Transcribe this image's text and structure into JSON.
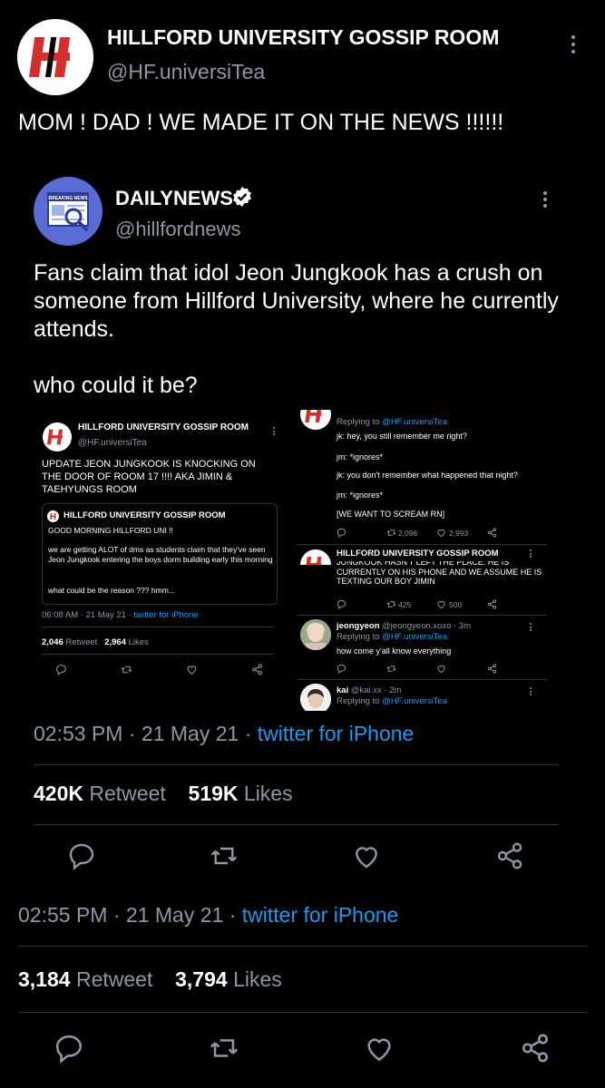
{
  "main": {
    "name": "HILLFORD UNIVERSITY GOSSIP ROOM",
    "handle": "@HF.universiTea",
    "text": "MOM ! DAD ! WE MADE IT ON THE NEWS !!!!!!",
    "time": "02:55 PM",
    "date": "21 May 21",
    "source": "twitter for iPhone",
    "retweet_count": "3,184",
    "retweet_label": "Retweet",
    "like_count": "3,794",
    "like_label": "Likes"
  },
  "quote": {
    "name": "DAILYNEWS",
    "handle": "@hillfordnews",
    "avatar_badge": "BREAKING NEWS",
    "text_1": "Fans claim that idol Jeon Jungkook has a crush on someone from Hillford University, where he currently attends.",
    "text_2": "who could it be?",
    "time": "02:53 PM",
    "date": "21 May 21",
    "source": "twitter for iPhone",
    "retweet_count": "420K",
    "retweet_label": "Retweet",
    "like_count": "519K",
    "like_label": "Likes"
  },
  "left_shot": {
    "name": "HILLFORD UNIVERSITY GOSSIP ROOM",
    "handle": "@HF.universiTea",
    "text": "UPDATE JEON JUNGKOOK IS KNOCKING ON THE DOOR OF ROOM 17 !!!! AKA JIMIN & TAEHYUNGS ROOM",
    "inner_name": "HILLFORD UNIVERSITY GOSSIP ROOM",
    "inner_line1": "GOOD MORNING HILLFORD UNI !!",
    "inner_line2": "we are getting ALOT of dms as students claim that they've seen Jeon Jungkook entering the boys dorm building early this morning",
    "inner_line3": "what could be the reason ??? hmm...",
    "meta_time": "06:08 AM · 21 May 21 ·",
    "meta_source": "twitter for iPhone",
    "retweet_count": "2,046",
    "retweet_label": "Retweet",
    "like_count": "2,964",
    "like_label": "Likes"
  },
  "right_shot": {
    "replying_prefix": "Replying to",
    "replying_handle": "@HF.universiTea",
    "chat": [
      "jk: hey, you still remember me right?",
      "jm: *ignores*",
      "jk: you don't remember what happened that night?",
      "jm: *ignores*",
      "[WE WANT TO SCREAM RN]"
    ],
    "r1_retweets": "2,096",
    "r1_likes": "2,993",
    "post2_name": "HILLFORD UNIVERSITY GOSSIP ROOM",
    "post2_text": "JUNGKOOK HASN'T LEFT THE PLACE. HE IS CURRENTLY ON HIS PHONE AND WE ASSUME HE IS TEXTING OUR BOY JIMIN",
    "r2_retweets": "425",
    "r2_likes": "500",
    "reply3_name": "jeongyeon",
    "reply3_meta": "@jeongyeon.xoxo · 3m",
    "reply3_replying_prefix": "Replying to",
    "reply3_replying_handle": "@HF.universiTea",
    "reply3_text": "how come y'all know everything",
    "reply4_name": "kai",
    "reply4_meta": "@kai.xx · 2m",
    "reply4_replying_prefix": "Replying to",
    "reply4_replying_handle": "@HF.universiTea"
  },
  "colors": {
    "background": "#000000",
    "text": "#e7e9ea",
    "muted": "#8b98a5",
    "link": "#1d9bf0",
    "logo_red": "#d32f2f",
    "verified_badge": "#ffffff"
  }
}
